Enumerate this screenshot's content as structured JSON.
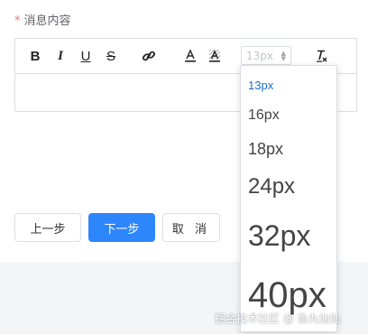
{
  "form": {
    "required_mark": "*",
    "label": "消息内容"
  },
  "toolbar": {
    "bold": "B",
    "italic": "I",
    "underline": "U",
    "strike": "S",
    "font_size_value": "13px"
  },
  "font_size_options": [
    "13px",
    "16px",
    "18px",
    "24px",
    "32px",
    "40px"
  ],
  "buttons": {
    "prev": "上一步",
    "next": "下一步",
    "cancel": "取 消"
  },
  "watermark": "掘金技术社区 @ 鱼丸仙仙",
  "colors": {
    "primary": "#2d86fb",
    "required": "#f56c6c",
    "selected_option": "#1a6fc9"
  }
}
